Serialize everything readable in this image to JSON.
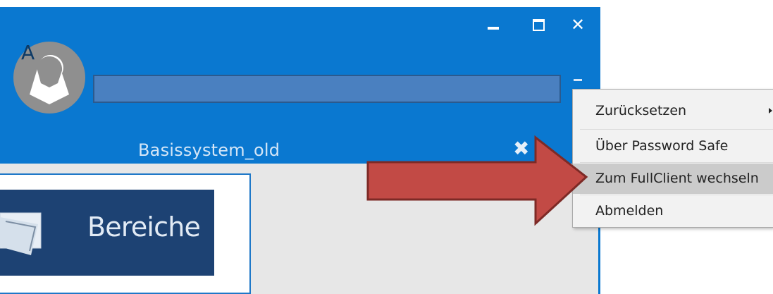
{
  "window": {
    "controls": {
      "minimize_icon": "minimize-icon",
      "maximize_icon": "maximize-icon",
      "close_icon": "close-icon",
      "close_glyph": "✕"
    },
    "avatar": {
      "letter": "A",
      "icon": "user-avatar-icon"
    },
    "search": {
      "value": "",
      "placeholder": ""
    }
  },
  "tab": {
    "title": "Basissystem_old",
    "close_glyph": "✖",
    "more_glyph": "⋯"
  },
  "tile": {
    "label": "Bereiche",
    "icon": "areas-icon"
  },
  "context_menu": {
    "items": [
      {
        "label": "Zurücksetzen",
        "has_submenu": true
      },
      {
        "label": "Über Password Safe"
      },
      {
        "label": "Zum FullClient wechseln",
        "highlighted": true
      },
      {
        "label": "Abmelden"
      }
    ]
  },
  "annotation": {
    "icon": "pointer-arrow-icon",
    "color": "#c24a45"
  },
  "colors": {
    "titlebar": "#0a78d0",
    "tile": "#1d4273",
    "menu_highlight": "#cbcbcb"
  }
}
